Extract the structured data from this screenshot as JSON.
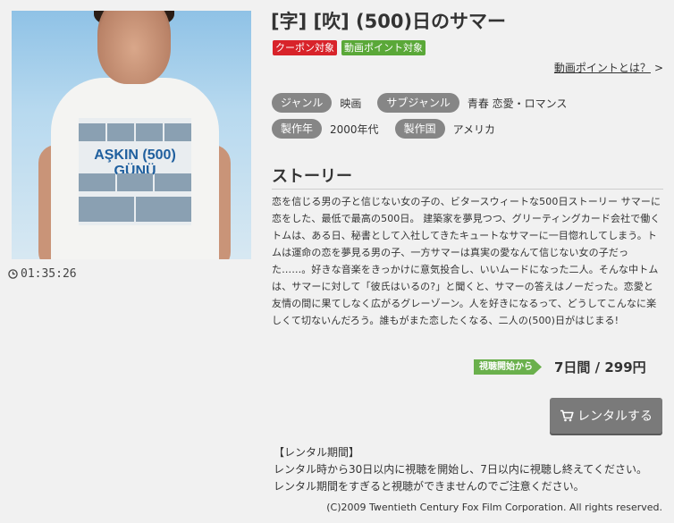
{
  "poster": {
    "tee_title": "AŞKIN (500) GÜNÜ"
  },
  "runtime": "01:35:26",
  "title": "[字] [吹] (500)日のサマー",
  "badges": {
    "coupon": "クーポン対象",
    "points": "動画ポイント対象"
  },
  "points_link": "動画ポイントとは？",
  "meta": {
    "genre_label": "ジャンル",
    "genre_value": "映画",
    "subgenre_label": "サブジャンル",
    "subgenre_value": "青春 恋愛・ロマンス",
    "year_label": "製作年",
    "year_value": "2000年代",
    "country_label": "製作国",
    "country_value": "アメリカ"
  },
  "story": {
    "heading": "ストーリー",
    "text": "恋を信じる男の子と信じない女の子の、ビタースウィートな500日ストーリー サマーに恋をした、最低で最高の500日。 建築家を夢見つつ、グリーティングカード会社で働くトムは、ある日、秘書として入社してきたキュートなサマーに一目惚れしてしまう。トムは運命の恋を夢見る男の子、一方サマーは真実の愛なんて信じない女の子だった……。好きな音楽をきっかけに意気投合し、いいムードになった二人。そんな中トムは、サマーに対して「彼氏はいるの?」と聞くと、サマーの答えはノーだった。恋愛と友情の間に果てしなく広がるグレーゾーン。人を好きになるって、どうしてこんなに楽しくて切ないんだろう。誰もがまた恋したくなる、二人の(500)日がはじまる!"
  },
  "price": {
    "tag": "視聴開始から",
    "value": "7日間 / 299円"
  },
  "rent_button": "レンタルする",
  "rental_info": {
    "heading": "【レンタル期間】",
    "line1": "レンタル時から30日以内に視聴を開始し、7日以内に視聴し終えてください。",
    "line2": "レンタル期間をすぎると視聴ができませんのでご注意ください。"
  },
  "copyright": "(C)2009 Twentieth Century Fox Film Corporation. All rights reserved.",
  "colors": {
    "coupon_badge": "#d8232a",
    "points_badge": "#5aa838",
    "pill": "#868686",
    "price_tag": "#6ab04c",
    "rent_button": "#7a7a7a",
    "background": "#f1f1f1"
  },
  "icons": {
    "runtime": "clock-icon",
    "rent_button": "cart-icon",
    "points_link": "chevron-right-icon"
  }
}
